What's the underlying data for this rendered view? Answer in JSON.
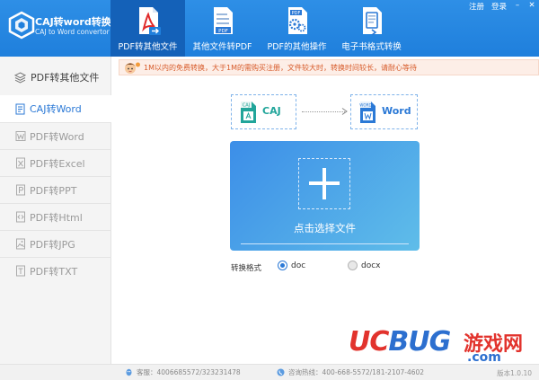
{
  "app": {
    "title": "CAJ转word转换器",
    "subtitle": "CAJ to Word convertor"
  },
  "window_controls": {
    "register": "注册",
    "login": "登录",
    "minimize": "–",
    "close": "✕"
  },
  "top_nav": [
    {
      "label": "PDF转其他文件",
      "icon": "pdf-file-icon",
      "active": true
    },
    {
      "label": "其他文件转PDF",
      "icon": "file-to-pdf-icon",
      "active": false
    },
    {
      "label": "PDF的其他操作",
      "icon": "pdf-gear-icon",
      "active": false
    },
    {
      "label": "电子书格式转换",
      "icon": "ebook-icon",
      "active": false
    }
  ],
  "sidebar": {
    "header": "PDF转其他文件",
    "items": [
      {
        "label": "CAJ转Word",
        "active": true
      },
      {
        "label": "PDF转Word",
        "active": false
      },
      {
        "label": "PDF转Excel",
        "active": false
      },
      {
        "label": "PDF转PPT",
        "active": false
      },
      {
        "label": "PDF转Html",
        "active": false
      },
      {
        "label": "PDF转JPG",
        "active": false
      },
      {
        "label": "PDF转TXT",
        "active": false
      }
    ]
  },
  "notice": {
    "text": "1M以内的免费转换，大于1M的需购买注册，文件较大时，转换时间较长，请耐心等待"
  },
  "conversion": {
    "source_label": "CAJ",
    "source_tag": "CAJ",
    "target_label": "Word",
    "target_tag": "WORD"
  },
  "upload": {
    "label": "点击选择文件"
  },
  "format": {
    "label": "转换格式",
    "options": [
      {
        "label": "doc",
        "selected": true
      },
      {
        "label": "docx",
        "selected": false
      }
    ]
  },
  "statusbar": {
    "qq": "客服：4006685572/323231478",
    "hotline": "咨询热线：400-668-5572/181-2107-4602",
    "version": "版本1.0.10"
  },
  "watermark": {
    "brand_uc": "UC",
    "brand_bug": "BUG",
    "brand_cn": "游戏网",
    "brand_com": ".com"
  },
  "colors": {
    "topbar": "#1f7fdc",
    "nav_active": "#1461b8",
    "accent": "#2b79d6",
    "caj_green": "#21a59a",
    "notice_text": "#d75b2a",
    "watermark_red": "#e2332d"
  }
}
